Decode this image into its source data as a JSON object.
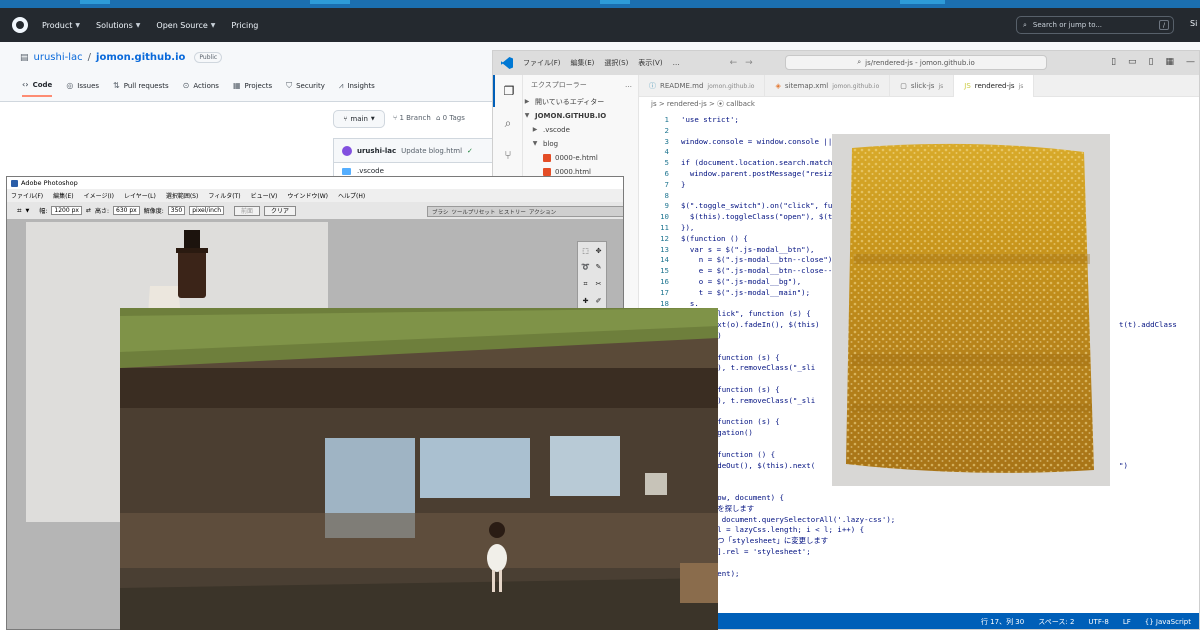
{
  "github": {
    "nav": {
      "items": [
        "Product",
        "Solutions",
        "Open Source",
        "Pricing"
      ],
      "search_placeholder": "Search or jump to...",
      "search_key": "/",
      "signin_partial": "Si"
    },
    "repo": {
      "owner": "urushi-lac",
      "separator": "/",
      "name": "jomon.github.io",
      "visibility": "Public"
    },
    "tabs": [
      {
        "label": "Code",
        "icon": "code-icon"
      },
      {
        "label": "Issues",
        "icon": "issue-icon"
      },
      {
        "label": "Pull requests",
        "icon": "pull-request-icon"
      },
      {
        "label": "Actions",
        "icon": "actions-icon"
      },
      {
        "label": "Projects",
        "icon": "projects-icon"
      },
      {
        "label": "Security",
        "icon": "shield-icon"
      },
      {
        "label": "Insights",
        "icon": "graph-icon"
      }
    ],
    "branch": "main",
    "branch_count": "1 Branch",
    "tag_count": "0 Tags",
    "commit": {
      "user": "urushi-lac",
      "message": "Update blog.html"
    },
    "file_row": ".vscode"
  },
  "vscode": {
    "menus": [
      "ファイル(F)",
      "編集(E)",
      "選択(S)",
      "表示(V)",
      "…"
    ],
    "command_center": "js/rendered-js - jomon.github.io",
    "explorer": {
      "title": "エクスプローラー",
      "open_editors": "開いているエディター",
      "root": "JOMON.GITHUB.IO",
      "rows": [
        ".vscode",
        "blog",
        "0000-e.html",
        "0000.html"
      ]
    },
    "tabs": [
      {
        "label": "README.md",
        "sub": "jomon.github.io"
      },
      {
        "label": "sitemap.xml",
        "sub": "jomon.github.io"
      },
      {
        "label": "slick-js",
        "sub": "js"
      },
      {
        "label": "rendered-js",
        "sub": "js"
      }
    ],
    "breadcrumb": "js > rendered-js > ⦿ callback",
    "code": [
      {
        "n": "1",
        "t": "'use strict';"
      },
      {
        "n": "2",
        "t": ""
      },
      {
        "n": "3",
        "t": "window.console = window.console || function (t) {};"
      },
      {
        "n": "4",
        "t": ""
      },
      {
        "n": "5",
        "t": "if (document.location.search.match(/"
      },
      {
        "n": "6",
        "t": "  window.parent.postMessage(\"resize\""
      },
      {
        "n": "7",
        "t": "}"
      },
      {
        "n": "8",
        "t": ""
      },
      {
        "n": "9",
        "t": "$(\".toggle_switch\").on(\"click\", func"
      },
      {
        "n": "10",
        "t": "  $(this).toggleClass(\"open\"), $(th"
      },
      {
        "n": "11",
        "t": "}),"
      },
      {
        "n": "12",
        "t": "$(function () {"
      },
      {
        "n": "13",
        "t": "  var s = $(\".js-modal__btn\"),"
      },
      {
        "n": "14",
        "t": "    n = $(\".js-modal__btn--close\"),"
      },
      {
        "n": "15",
        "t": "    e = $(\".js-modal__btn--close--fi"
      },
      {
        "n": "16",
        "t": "    o = $(\".js-modal__bg\"),"
      },
      {
        "n": "17",
        "t": "    t = $(\".js-modal__main\");"
      },
      {
        "n": "18",
        "t": "  s."
      }
    ],
    "code_right": [
      {
        "t": "on(\"click\", function (s) {"
      },
      {
        "t": "s).next(o).fadeIn(), $(this)",
        "tail": "t(t).addClass"
      },
      {
        "t": "deUp\")"
      },
      {
        "t": ""
      },
      {
        "t": "ck\", function (s) {"
      },
      {
        "t": "dOut(), t.removeClass(\"_sli"
      },
      {
        "t": ""
      },
      {
        "t": "ck\", function (s) {"
      },
      {
        "t": "dOut(), t.removeClass(\"_sli"
      },
      {
        "t": ""
      },
      {
        "t": "ck\", function (s) {"
      },
      {
        "t": "Propagation()"
      },
      {
        "t": ""
      },
      {
        "t": "ck\", function () {"
      },
      {
        "t": "s).fadeOut(), $(this).next(",
        "tail": "\")"
      },
      {
        "t": ""
      },
      {
        "t": ""
      },
      {
        "t": "(window, document) {"
      },
      {
        "t": "-css を探します"
      },
      {
        "t": "Css = document.querySelectorAll('.lazy-css');"
      },
      {
        "t": "= 0, l = lazyCss.length; i < l; i++) {"
      },
      {
        "t": "一つずつ「stylesheet」に変更します"
      },
      {
        "t": "Css[i].rel = 'stylesheet';"
      },
      {
        "t": ""
      },
      {
        "t": "document);"
      }
    ],
    "status": [
      "行 17、列 30",
      "スペース: 2",
      "UTF-8",
      "LF",
      "{} JavaScript"
    ]
  },
  "photoshop": {
    "title": "Adobe Photoshop",
    "menus": [
      "ファイル(F)",
      "編集(E)",
      "イメージ(I)",
      "レイヤー(L)",
      "選択範囲(S)",
      "フィルタ(T)",
      "ビュー(V)",
      "ウインドウ(W)",
      "ヘルプ(H)"
    ],
    "opts": {
      "width_label": "幅:",
      "width": "1200 px",
      "height_label": "高さ:",
      "height": "630 px",
      "res_label": "解像度:",
      "res": "350",
      "res_unit": "pixel/inch",
      "front": "前面",
      "clear": "クリア"
    },
    "palette_tabs": [
      "ブラシ",
      "ツールプリセット",
      "ヒストリー",
      "アクション"
    ]
  },
  "colors": {
    "gh_nav": "#24292f",
    "gh_link": "#0969da",
    "vsc_status": "#005fb8",
    "lacquer": "#c89a1c"
  }
}
